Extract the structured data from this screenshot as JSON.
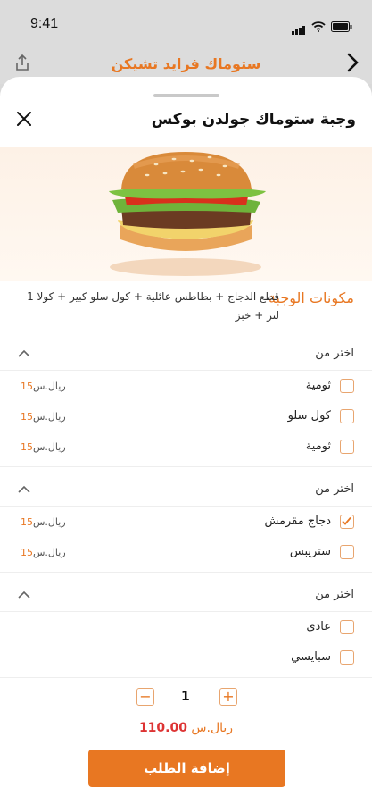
{
  "status": {
    "time": "9:41"
  },
  "appbar": {
    "title": "ستوماك فرايد تشيكن",
    "back_icon": "chevron-right-icon",
    "share_icon": "share-icon"
  },
  "sheet": {
    "title": "وجبة ستوماك جولدن بوكس",
    "close_icon": "close-icon"
  },
  "meal": {
    "section_title": "مكونات الوجبة",
    "description": "قطع الدجاج + بطاطس عائلية + كول سلو كبير + كولا 1 لتر + خبز"
  },
  "sections": [
    {
      "label": "اختر من",
      "options": [
        {
          "name": "ثومية",
          "price": "15",
          "currency": "ريال.س",
          "checked": false
        },
        {
          "name": "كول سلو",
          "price": "15",
          "currency": "ريال.س",
          "checked": false
        },
        {
          "name": "ثومية",
          "price": "15",
          "currency": "ريال.س",
          "checked": false
        }
      ]
    },
    {
      "label": "اختر من",
      "options": [
        {
          "name": "دجاج مقرمش",
          "price": "15",
          "currency": "ريال.س",
          "checked": true
        },
        {
          "name": "ستريبس",
          "price": "15",
          "currency": "ريال.س",
          "checked": false
        }
      ]
    },
    {
      "label": "اختر من",
      "options": [
        {
          "name": "عادي",
          "checked": false
        },
        {
          "name": "سبايسي",
          "checked": false
        }
      ]
    }
  ],
  "quantity": {
    "value": "1",
    "minus": "−",
    "plus": "+"
  },
  "total": {
    "amount": "110.00",
    "currency": "ريال.س"
  },
  "order_button": "إضافة الطلب",
  "colors": {
    "accent": "#e87722",
    "price_red": "#dd3333"
  }
}
